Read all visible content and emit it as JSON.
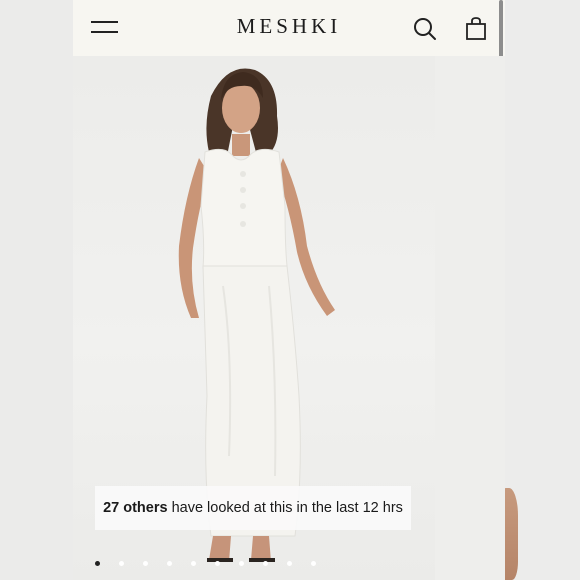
{
  "header": {
    "brand": "MESHKI",
    "menu_icon": "hamburger-menu-icon",
    "search_icon": "search-icon",
    "bag_icon": "shopping-bag-icon"
  },
  "product": {
    "viewers_count": "27 others",
    "viewers_suffix": "have looked at this in the last 12 hrs"
  },
  "carousel": {
    "total_images": 10,
    "active_index": 0
  },
  "colors": {
    "header_bg": "#f7f6f1",
    "brand_text": "#1c1c1c",
    "active_dot": "#222222",
    "inactive_dot": "#ffffff"
  }
}
